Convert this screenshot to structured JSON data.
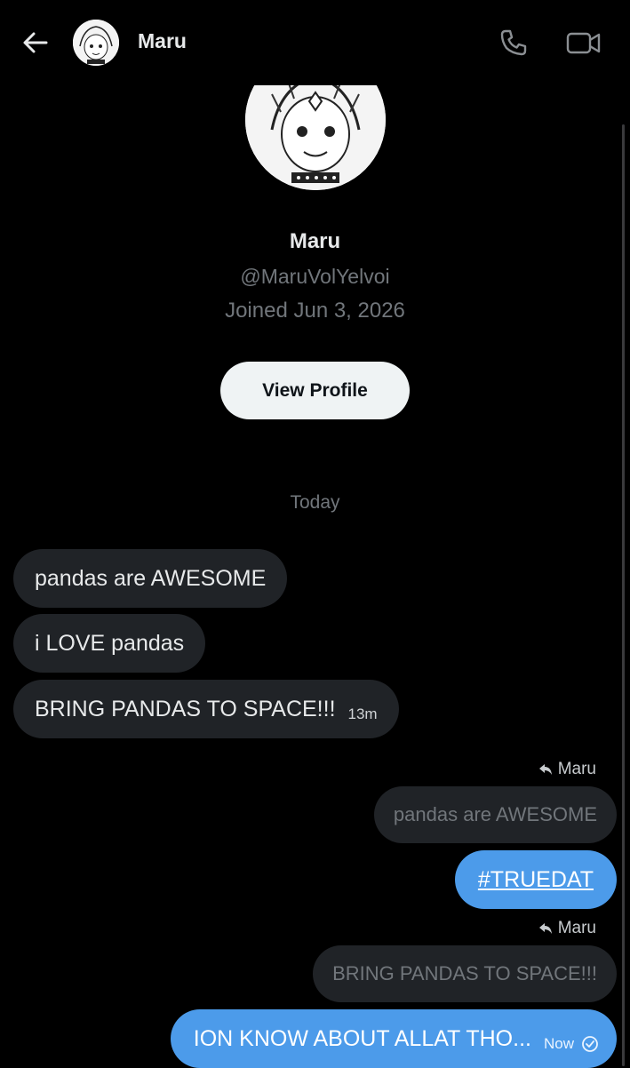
{
  "header": {
    "title": "Maru",
    "back_icon": "arrow-left-icon",
    "call_icon": "phone-icon",
    "video_icon": "video-camera-icon"
  },
  "profile": {
    "name": "Maru",
    "handle": "@MaruVolYelvoi",
    "joined": "Joined Jun 3, 2026",
    "view_profile_label": "View Profile"
  },
  "conversation": {
    "date_separator": "Today",
    "incoming": [
      {
        "text": "pandas are AWESOME"
      },
      {
        "text": "i LOVE pandas"
      },
      {
        "text": "BRING PANDAS TO SPACE!!!",
        "time": "13m"
      }
    ],
    "outgoing": [
      {
        "reply_to": "Maru",
        "quoted": "pandas are AWESOME",
        "text": "#TRUEDAT"
      },
      {
        "reply_to": "Maru",
        "quoted": "BRING PANDAS TO SPACE!!!",
        "text": "ION KNOW ABOUT ALLAT THO...",
        "time": "Now",
        "status_icon": "check-circle-icon"
      }
    ]
  },
  "colors": {
    "background": "#000000",
    "bubble_incoming": "#202327",
    "bubble_outgoing": "#4c9bea",
    "muted_text": "#71767b",
    "button_bg": "#eff3f4"
  }
}
